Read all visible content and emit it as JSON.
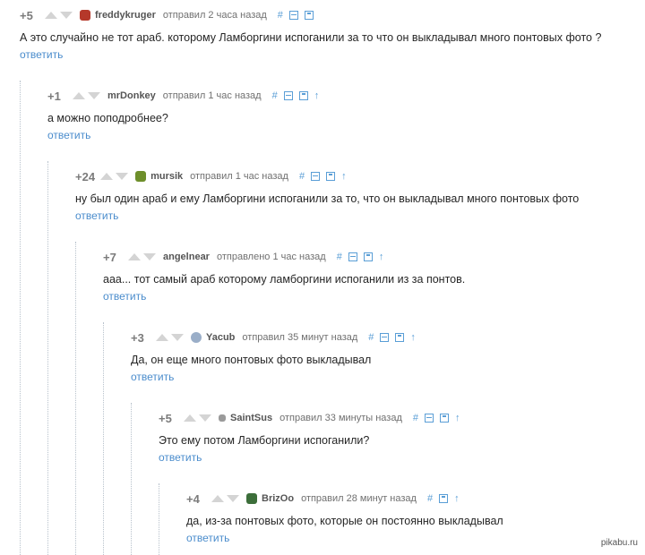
{
  "comments": [
    {
      "rating": "+5",
      "user": "freddykruger",
      "avatar_color": "#b5382a",
      "time": "отправил 2 часа назад",
      "text": "А это случайно не тот араб. которому Ламборгини испоганили за то что он выкладывал много понтовых фото ?",
      "reply": "ответить"
    },
    {
      "rating": "+1",
      "user": "mrDonkey",
      "avatar_color": "",
      "time": "отправил 1 час назад",
      "text": "а можно поподробнее?",
      "reply": "ответить"
    },
    {
      "rating": "+24",
      "user": "mursik",
      "avatar_color": "#6e8f2b",
      "time": "отправил 1 час назад",
      "text": "ну был один араб и ему Ламборгини испоганили за то, что он выкладывал много понтовых фото",
      "reply": "ответить"
    },
    {
      "rating": "+7",
      "user": "angelnear",
      "avatar_color": "",
      "time": "отправлено 1 час назад",
      "text": "ааа... тот самый араб которому ламборгини испоганили из за понтов.",
      "reply": "ответить"
    },
    {
      "rating": "+3",
      "user": "Yacub",
      "avatar_color": "#9aaec8",
      "time": "отправил 35 минут назад",
      "text": "Да, он еще много понтовых фото выкладывал",
      "reply": "ответить"
    },
    {
      "rating": "+5",
      "user": "SaintSus",
      "avatar_color": "#9a9a9a",
      "time": "отправил 33 минуты назад",
      "text": "Это ему потом Ламборгини испоганили?",
      "reply": "ответить"
    },
    {
      "rating": "+4",
      "user": "BrizOo",
      "avatar_color": "#3c6e3a",
      "time": "отправил 28 минут назад",
      "text": "да, из-за понтовых фото, которые он постоянно выкладывал",
      "reply": "ответить"
    }
  ],
  "icons": {
    "anchor": "#",
    "collapse": "collapse-icon",
    "save": "save-icon",
    "parent": "↑"
  },
  "watermark": "pikabu.ru",
  "accent_color": "#4a8ccc"
}
